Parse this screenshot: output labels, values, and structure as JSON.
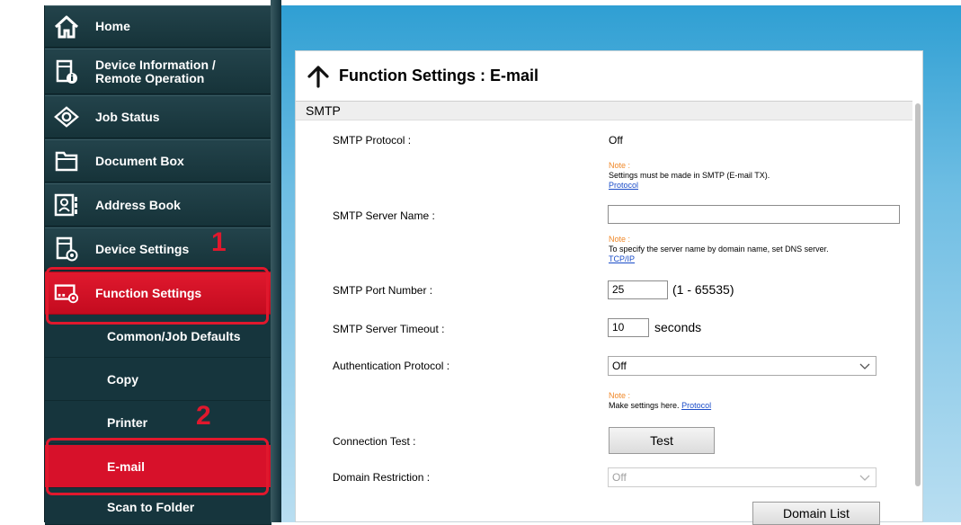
{
  "sidebar": {
    "items": [
      {
        "label": "Home",
        "icon": "home-icon"
      },
      {
        "label": "Device Information /",
        "label2": "Remote Operation",
        "icon": "device-info-icon"
      },
      {
        "label": "Job Status",
        "icon": "eye-icon"
      },
      {
        "label": "Document Box",
        "icon": "folder-icon"
      },
      {
        "label": "Address Book",
        "icon": "address-book-icon"
      },
      {
        "label": "Device Settings",
        "icon": "device-settings-icon"
      },
      {
        "label": "Function Settings",
        "icon": "function-settings-icon"
      }
    ],
    "sub_items": [
      {
        "label": "Common/Job Defaults"
      },
      {
        "label": "Copy"
      },
      {
        "label": "Printer"
      },
      {
        "label": "E-mail"
      },
      {
        "label": "Scan to Folder"
      }
    ]
  },
  "callouts": {
    "step1": "1",
    "step2": "2"
  },
  "panel": {
    "title": "Function Settings : E-mail",
    "section": "SMTP",
    "smtp_protocol": {
      "label": "SMTP Protocol :",
      "value": "Off"
    },
    "note1": {
      "head": "Note :",
      "text": "Settings must be made in SMTP (E-mail TX).",
      "link": "Protocol"
    },
    "smtp_server_name": {
      "label": "SMTP Server Name :",
      "value": ""
    },
    "note2": {
      "head": "Note :",
      "text": "To specify the server name by domain name, set DNS server.",
      "link": "TCP/IP"
    },
    "smtp_port": {
      "label": "SMTP Port Number :",
      "value": "25",
      "range": "(1 - 65535)"
    },
    "smtp_timeout": {
      "label": "SMTP Server Timeout :",
      "value": "10",
      "unit": "seconds"
    },
    "auth_protocol": {
      "label": "Authentication Protocol :",
      "value": "Off"
    },
    "note3": {
      "head": "Note :",
      "text": "Make settings here.",
      "link": "Protocol"
    },
    "connection_test": {
      "label": "Connection Test :",
      "button": "Test"
    },
    "domain_restriction": {
      "label": "Domain Restriction :",
      "value": "Off"
    },
    "domain_list_button": "Domain List"
  },
  "colors": {
    "accent_red": "#d7112a",
    "sidebar_bg": "#16353d",
    "note_orange": "#f0892a",
    "link_blue": "#1a4cc8"
  }
}
